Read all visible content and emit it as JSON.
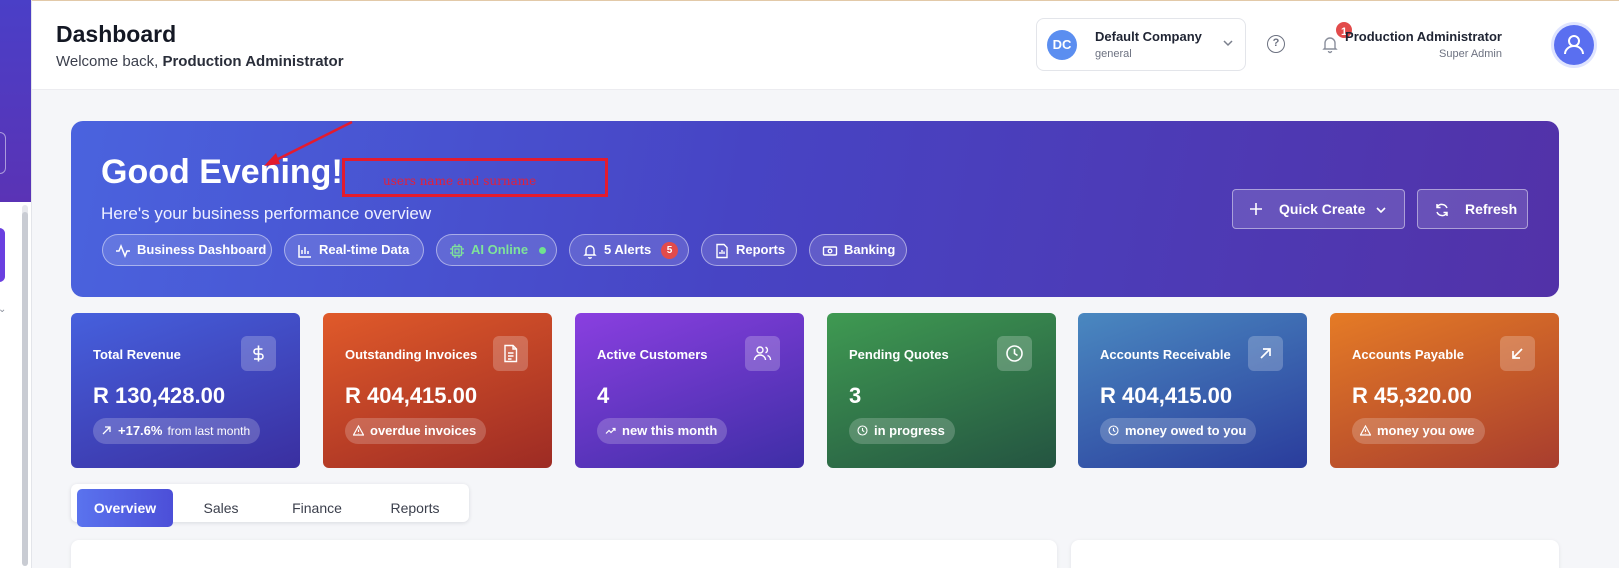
{
  "header": {
    "title": "Dashboard",
    "welcome_prefix": "Welcome back,",
    "welcome_user": "Production Administrator",
    "company": {
      "initials": "DC",
      "name": "Default Company",
      "sub": "general"
    },
    "notification_count": "1",
    "help_glyph": "?",
    "user": {
      "name": "Production Administrator",
      "role": "Super Admin"
    }
  },
  "hero": {
    "greeting": "Good Evening!",
    "subtitle": "Here's your business performance overview",
    "chips": [
      {
        "label": "Business Dashboard",
        "icon": "activity-icon"
      },
      {
        "label": "Real-time Data",
        "icon": "bar-chart-icon"
      },
      {
        "label": "AI Online",
        "icon": "cpu-icon"
      },
      {
        "label": "5 Alerts",
        "icon": "bell-icon",
        "badge": "5"
      },
      {
        "label": "Reports",
        "icon": "file-chart-icon"
      },
      {
        "label": "Banking",
        "icon": "banknote-icon"
      }
    ],
    "quick_create_label": "Quick Create",
    "refresh_label": "Refresh"
  },
  "annotation": {
    "text": "users name and surname",
    "color": "#e31b2e"
  },
  "cards": [
    {
      "label": "Total Revenue",
      "value": "R 130,428.00",
      "pill": "+17.6%",
      "pill_muted": "from last month",
      "icon": "dollar-icon",
      "colors": [
        "#4660dd",
        "#3a2fa0"
      ]
    },
    {
      "label": "Outstanding Invoices",
      "value": "R 404,415.00",
      "pill": "overdue invoices",
      "icon": "file-text-icon",
      "colors": [
        "#e05a2a",
        "#9d2b24"
      ]
    },
    {
      "label": "Active Customers",
      "value": "4",
      "pill": "new this month",
      "icon": "users-icon",
      "colors": [
        "#8a3fe0",
        "#3e2ea6"
      ]
    },
    {
      "label": "Pending Quotes",
      "value": "3",
      "pill": "in progress",
      "icon": "clock-icon",
      "colors": [
        "#3f9a52",
        "#245441"
      ]
    },
    {
      "label": "Accounts Receivable",
      "value": "R 404,415.00",
      "pill": "money owed to you",
      "icon": "arrow-up-right-icon",
      "colors": [
        "#4a88c0",
        "#2a3c9c"
      ]
    },
    {
      "label": "Accounts Payable",
      "value": "R 45,320.00",
      "pill": "money you owe",
      "icon": "arrow-down-left-icon",
      "colors": [
        "#e57b26",
        "#a83d2e"
      ]
    }
  ],
  "tabs": [
    "Overview",
    "Sales",
    "Finance",
    "Reports"
  ]
}
